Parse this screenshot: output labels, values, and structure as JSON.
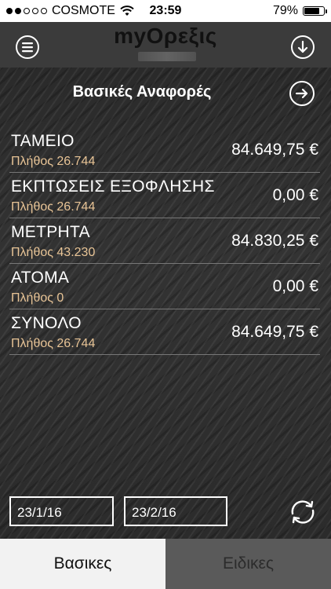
{
  "status_bar": {
    "carrier": "COSMOTE",
    "time": "23:59",
    "battery": "79%",
    "battery_level": 0.79,
    "signal_bars": 2
  },
  "header": {
    "title": "myΟρεξις"
  },
  "section": {
    "title": "Βασικές Αναφορές"
  },
  "reports": [
    {
      "label": "ΤΑΜΕΙΟ",
      "count": "Πλήθος 26.744",
      "value": "84.649,75 €"
    },
    {
      "label": "ΕΚΠΤΩΣΕΙΣ ΕΞΟΦΛΗΣΗΣ",
      "count": "Πλήθος 26.744",
      "value": "0,00 €"
    },
    {
      "label": "ΜΕΤΡΗΤΑ",
      "count": "Πλήθος 43.230",
      "value": "84.830,25 €"
    },
    {
      "label": "ΑΤΟΜΑ",
      "count": "Πλήθος 0",
      "value": "0,00 €"
    },
    {
      "label": "ΣΥΝΟΛΟ",
      "count": "Πλήθος 26.744",
      "value": "84.649,75 €"
    }
  ],
  "filters": {
    "date_from": "23/1/16",
    "date_to": "23/2/16"
  },
  "tabs": {
    "basic": "Βασικες",
    "special": "Ειδικες",
    "active": "basic"
  },
  "colors": {
    "accent_count": "#e8c496",
    "background": "#2a2a2a",
    "tab_active_bg": "#f2f2f2",
    "tab_inactive_bg": "#5a5a5a"
  },
  "icons": {
    "menu": "hamburger-circle-icon",
    "download": "arrow-down-circle-icon",
    "next": "arrow-right-circle-icon",
    "refresh": "refresh-icon",
    "wifi": "wifi-icon"
  }
}
